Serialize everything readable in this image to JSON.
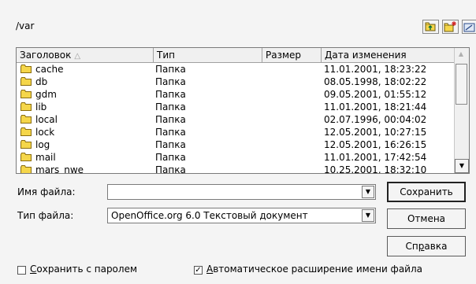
{
  "path": "/var",
  "toolbar": {
    "icons": [
      "folder-up-icon",
      "new-folder-icon",
      "default-dir-icon"
    ]
  },
  "list": {
    "columns": [
      "Заголовок",
      "Тип",
      "Размер",
      "Дата изменения"
    ],
    "rows": [
      {
        "name": "cache",
        "type": "Папка",
        "size": "",
        "date": "11.01.2001, 18:23:22"
      },
      {
        "name": "db",
        "type": "Папка",
        "size": "",
        "date": "08.05.1998, 18:02:22"
      },
      {
        "name": "gdm",
        "type": "Папка",
        "size": "",
        "date": "09.05.2001, 01:55:12"
      },
      {
        "name": "lib",
        "type": "Папка",
        "size": "",
        "date": "11.01.2001, 18:21:44"
      },
      {
        "name": "local",
        "type": "Папка",
        "size": "",
        "date": "02.07.1996, 00:04:02"
      },
      {
        "name": "lock",
        "type": "Папка",
        "size": "",
        "date": "12.05.2001, 10:27:15"
      },
      {
        "name": "log",
        "type": "Папка",
        "size": "",
        "date": "12.05.2001, 16:26:15"
      },
      {
        "name": "mail",
        "type": "Папка",
        "size": "",
        "date": "11.01.2001, 17:42:54"
      },
      {
        "name": "mars_nwe",
        "type": "Папка",
        "size": "",
        "date": "10.25.2001, 18:32:10"
      }
    ]
  },
  "form": {
    "filename_label": "Имя файла:",
    "filename_value": "",
    "filetype_label": "Тип файла:",
    "filetype_value": "OpenOffice.org 6.0 Текстовый документ"
  },
  "buttons": {
    "save": "Сохранить",
    "cancel": "Отмена",
    "help_pre": "Сп",
    "help_hot": "р",
    "help_post": "авка"
  },
  "options": {
    "save_password": {
      "hot": "С",
      "rest": "охранить с паролем",
      "checked": false
    },
    "auto_ext": {
      "hot": "А",
      "rest": "втоматическое расширение имени файла",
      "checked": true
    }
  },
  "colors": {
    "folder": "#f5d64a",
    "folder_outline": "#8a6d10"
  }
}
